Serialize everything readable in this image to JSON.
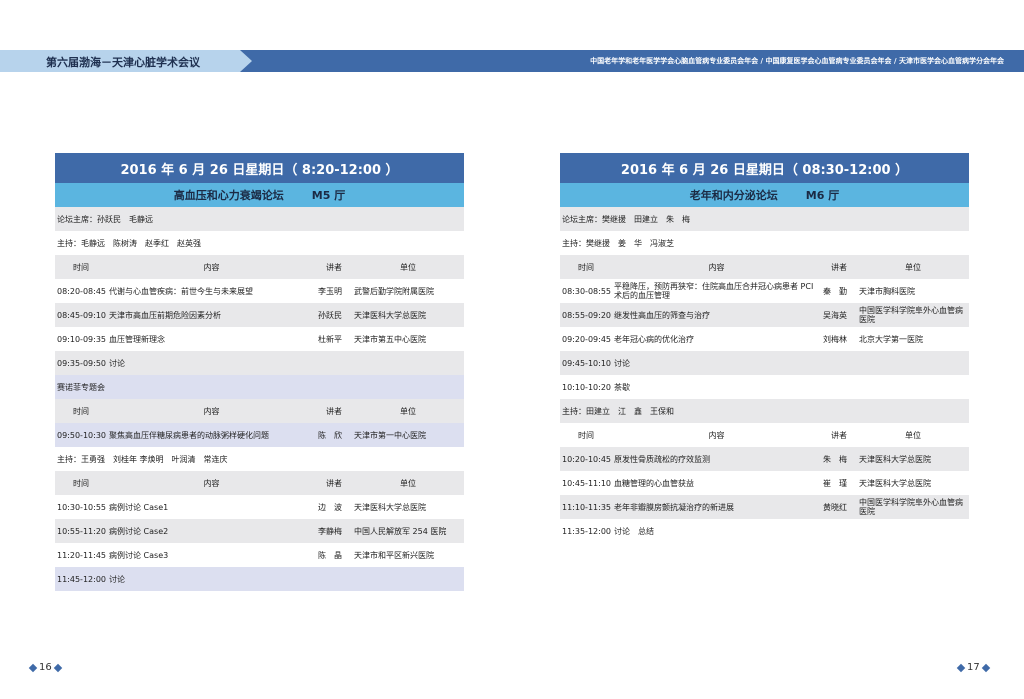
{
  "header": {
    "title": "第六届渤海－天津心脏学术会议",
    "orgs": "中国老年学和老年医学学会心脑血管病专业委员会年会 / 中国康复医学会心血管病专业委员会年会 / 天津市医学会心血管病学分会年会"
  },
  "left": {
    "date": "2016 年 6 月 26 日星期日（ 8:20-12:00 ）",
    "forum": "高血压和心力衰竭论坛",
    "hall": "M5 厅",
    "chair": "论坛主席：孙跃民　毛静远",
    "host1": "主持：毛静远　陈树涛　赵季红　赵英强",
    "cols": {
      "time": "时间",
      "content": "内容",
      "speaker": "讲者",
      "unit": "单位"
    },
    "rows1": [
      {
        "time": "08:20-08:45",
        "content": "代谢与心血管疾病：前世今生与未来展望",
        "speaker": "李玉明",
        "unit": "武警后勤学院附属医院"
      },
      {
        "time": "08:45-09:10",
        "content": "天津市高血压前期危险因素分析",
        "speaker": "孙跃民",
        "unit": "天津医科大学总医院"
      },
      {
        "time": "09:10-09:35",
        "content": "血压管理新理念",
        "speaker": "杜新平",
        "unit": "天津市第五中心医院"
      }
    ],
    "discuss1": {
      "time": "09:35-09:50",
      "content": "讨论"
    },
    "special": "赛诺菲专题会",
    "rows2": [
      {
        "time": "09:50-10:30",
        "content": "聚焦高血压伴糖尿病患者的动脉粥样硬化问题",
        "speaker": "陈　欣",
        "unit": "天津市第一中心医院"
      }
    ],
    "host2": "主持：王勇强　刘桂年 李焕明　叶润清　常连庆",
    "rows3": [
      {
        "time": "10:30-10:55",
        "content": "病例讨论 Case1",
        "speaker": "边　波",
        "unit": "天津医科大学总医院"
      },
      {
        "time": "10:55-11:20",
        "content": "病例讨论 Case2",
        "speaker": "李静梅",
        "unit": "中国人民解放军 254 医院"
      },
      {
        "time": "11:20-11:45",
        "content": "病例讨论 Case3",
        "speaker": "陈　晶",
        "unit": "天津市和平区新兴医院"
      }
    ],
    "discuss2": {
      "time": "11:45-12:00",
      "content": "讨论"
    }
  },
  "right": {
    "date": "2016 年 6 月 26 日星期日（ 08:30-12:00 ）",
    "forum": "老年和内分泌论坛",
    "hall": "M6 厅",
    "chair": "论坛主席：樊继援　田建立　朱　梅",
    "host1": "主持：樊继援　姜　华　冯淑芝",
    "cols": {
      "time": "时间",
      "content": "内容",
      "speaker": "讲者",
      "unit": "单位"
    },
    "rows1": [
      {
        "time": "08:30-08:55",
        "content": "平稳降压，预防再狭窄：住院高血压合并冠心病患者 PCI 术后的血压管理",
        "speaker": "秦　勤",
        "unit": "天津市胸科医院"
      },
      {
        "time": "08:55-09:20",
        "content": "继发性高血压的筛查与治疗",
        "speaker": "吴海英",
        "unit": "中国医学科学院阜外心血管病医院"
      },
      {
        "time": "09:20-09:45",
        "content": "老年冠心病的优化治疗",
        "speaker": "刘梅林",
        "unit": "北京大学第一医院"
      }
    ],
    "discuss1": {
      "time": "09:45-10:10",
      "content": "讨论"
    },
    "break": {
      "time": "10:10-10:20",
      "content": "茶歇"
    },
    "host2": "主持：田建立　江　鑫　王保和",
    "rows2": [
      {
        "time": "10:20-10:45",
        "content": "原发性骨质疏松的疗效监测",
        "speaker": "朱　梅",
        "unit": "天津医科大学总医院"
      },
      {
        "time": "10:45-11:10",
        "content": "血糖管理的心血管获益",
        "speaker": "崔　瑾",
        "unit": "天津医科大学总医院"
      },
      {
        "time": "11:10-11:35",
        "content": "老年非瓣膜房颤抗凝治疗的新进展",
        "speaker": "黄晓红",
        "unit": "中国医学科学院阜外心血管病医院"
      }
    ],
    "closing": {
      "time": "11:35-12:00",
      "content": "讨论　总结"
    }
  },
  "pages": {
    "left": "16",
    "right": "17"
  },
  "colors": {
    "dark_blue": "#3f6aa8",
    "light_blue": "#5bb5e0",
    "header_left": "#b7d3ec",
    "grey_row": "#e8e8ea",
    "lavender_row": "#dcdff0"
  }
}
